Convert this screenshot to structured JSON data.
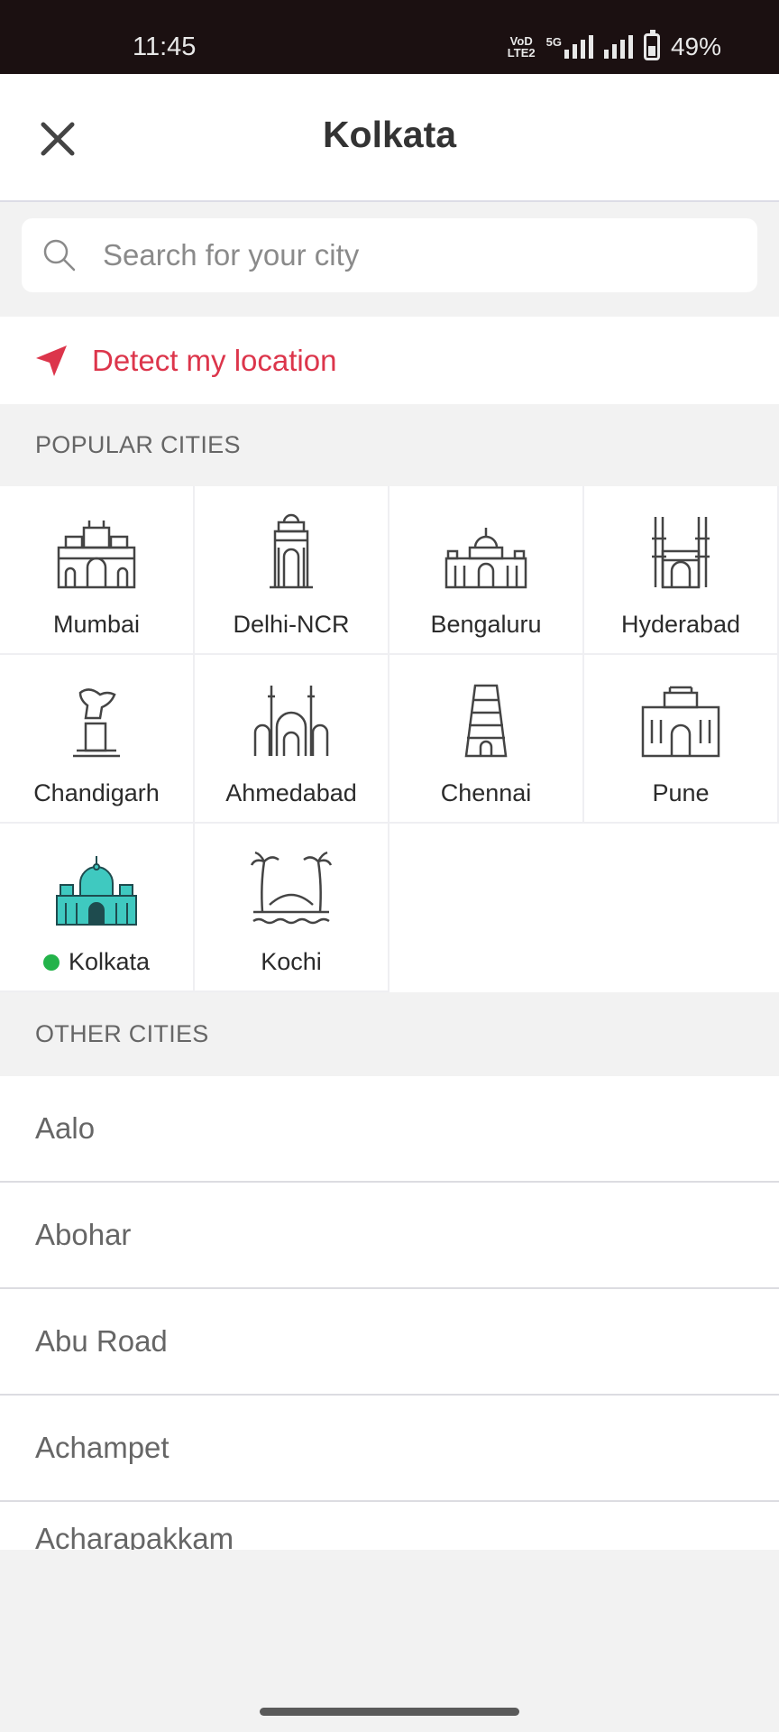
{
  "status": {
    "time": "11:45",
    "net_top": "VoD",
    "net_bottom": "LTE2",
    "net_5g": "5G",
    "battery": "49%"
  },
  "header": {
    "title": "Kolkata"
  },
  "search": {
    "placeholder": "Search for your city"
  },
  "detect": {
    "label": "Detect my location"
  },
  "popular": {
    "heading": "POPULAR CITIES",
    "cities": [
      {
        "name": "Mumbai",
        "icon": "gateway-of-india-icon"
      },
      {
        "name": "Delhi-NCR",
        "icon": "india-gate-icon"
      },
      {
        "name": "Bengaluru",
        "icon": "vidhana-soudha-icon"
      },
      {
        "name": "Hyderabad",
        "icon": "charminar-icon"
      },
      {
        "name": "Chandigarh",
        "icon": "open-hand-monument-icon"
      },
      {
        "name": "Ahmedabad",
        "icon": "ahmedabad-mosque-icon"
      },
      {
        "name": "Chennai",
        "icon": "temple-gopuram-icon"
      },
      {
        "name": "Pune",
        "icon": "shaniwar-wada-icon"
      },
      {
        "name": "Kolkata",
        "icon": "victoria-memorial-icon",
        "selected": true,
        "accent": "#3fc9c0"
      },
      {
        "name": "Kochi",
        "icon": "palm-trees-icon"
      }
    ]
  },
  "other": {
    "heading": "OTHER CITIES",
    "cities": [
      "Aalo",
      "Abohar",
      "Abu Road",
      "Achampet",
      "Acharapakkam"
    ]
  },
  "colors": {
    "accent_red": "#dc354b",
    "selected_dot": "#23b34a",
    "icon_stroke": "#444444"
  }
}
